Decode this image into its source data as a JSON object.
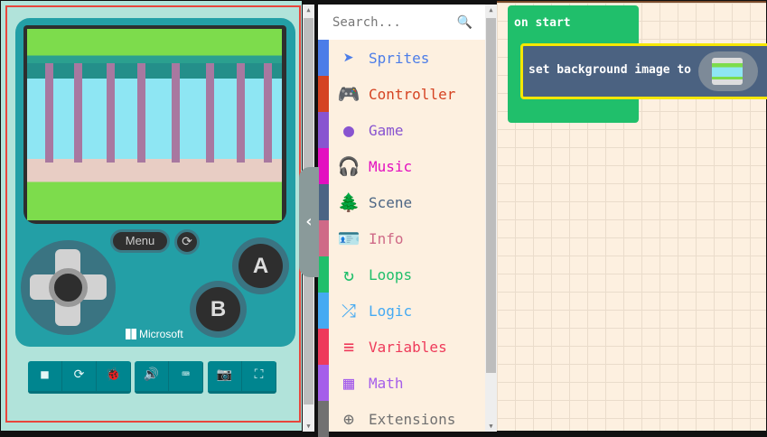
{
  "simulator": {
    "menu_label": "Menu",
    "brand": "Microsoft",
    "button_a": "A",
    "button_b": "B",
    "toolbar": [
      {
        "name": "stop",
        "icon": "■"
      },
      {
        "name": "restart",
        "icon": "⟳"
      },
      {
        "name": "debug",
        "icon": "🐞"
      },
      {
        "name": "sound",
        "icon": "🔊"
      },
      {
        "name": "keyboard",
        "icon": "⌨"
      },
      {
        "name": "screenshot",
        "icon": "📷"
      },
      {
        "name": "fullscreen",
        "icon": "⛶"
      }
    ]
  },
  "toolbox": {
    "search_placeholder": "Search...",
    "categories": [
      {
        "label": "Sprites",
        "color": "#4c7de8",
        "icon": "➤"
      },
      {
        "label": "Controller",
        "color": "#d54322",
        "icon": "🎮"
      },
      {
        "label": "Game",
        "color": "#8854d0",
        "icon": "●"
      },
      {
        "label": "Music",
        "color": "#e30fc0",
        "icon": "🎧"
      },
      {
        "label": "Scene",
        "color": "#4b6584",
        "icon": "🌲"
      },
      {
        "label": "Info",
        "color": "#cf6a87",
        "icon": "🪪"
      },
      {
        "label": "Loops",
        "color": "#20bf6b",
        "icon": "↻"
      },
      {
        "label": "Logic",
        "color": "#45aaf2",
        "icon": "⤮"
      },
      {
        "label": "Variables",
        "color": "#ee3a5a",
        "icon": "≡"
      },
      {
        "label": "Math",
        "color": "#a55eea",
        "icon": "▦"
      },
      {
        "label": "Extensions",
        "color": "#717171",
        "icon": "⊕"
      }
    ]
  },
  "workspace": {
    "on_start": "on start",
    "set_bg": "set background image to"
  }
}
